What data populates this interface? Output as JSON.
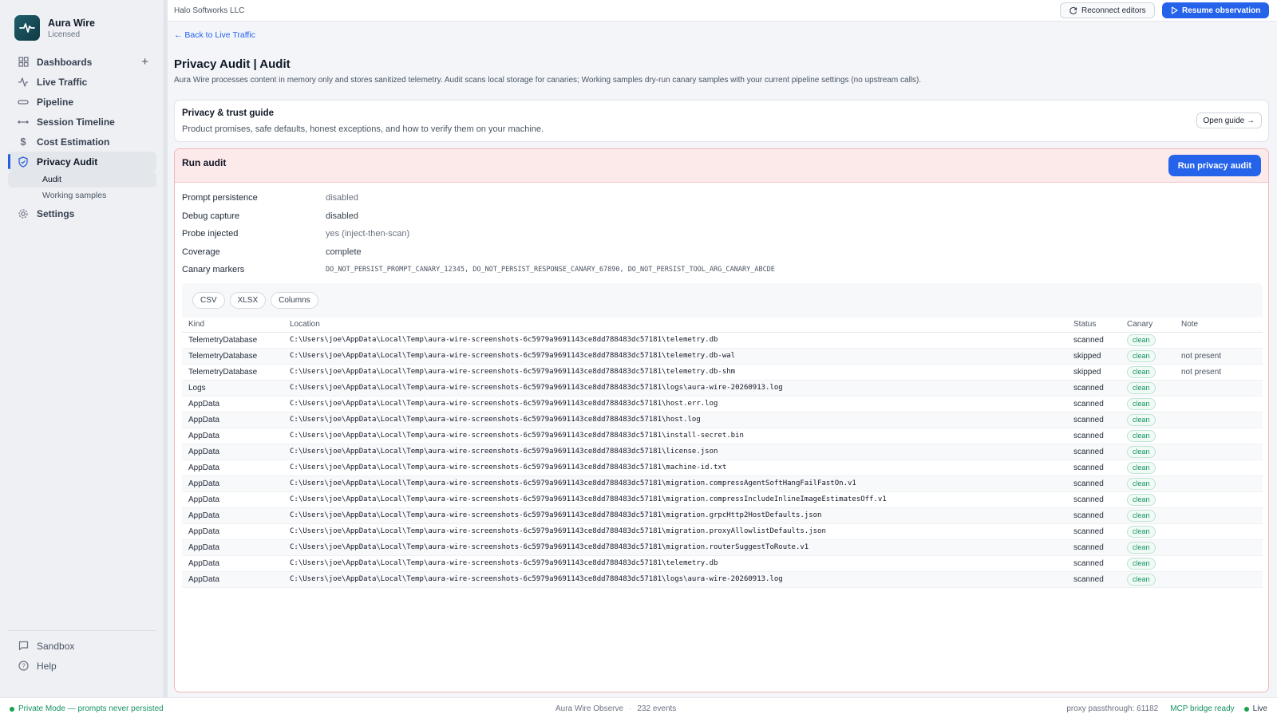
{
  "brand": {
    "name": "Aura Wire",
    "license": "Licensed"
  },
  "nav": {
    "dashboards": "Dashboards",
    "live_traffic": "Live Traffic",
    "pipeline": "Pipeline",
    "session_timeline": "Session Timeline",
    "cost_estimation": "Cost Estimation",
    "privacy_audit": "Privacy Audit",
    "sub_audit": "Audit",
    "sub_working_samples": "Working samples",
    "settings": "Settings"
  },
  "sidebar_bottom": {
    "sandbox": "Sandbox",
    "help": "Help"
  },
  "topbar": {
    "company": "Halo Softworks LLC",
    "reconnect": "Reconnect editors",
    "resume": "Resume observation"
  },
  "page": {
    "back": "← Back to Live Traffic",
    "title": "Privacy Audit | Audit",
    "description": "Aura Wire processes content in memory only and stores sanitized telemetry. Audit scans local storage for canaries; Working samples dry-run canary samples with your current pipeline settings (no upstream calls)."
  },
  "guide": {
    "title": "Privacy & trust guide",
    "description": "Product promises, safe defaults, honest exceptions, and how to verify them on your machine.",
    "button": "Open guide →"
  },
  "audit": {
    "title": "Run audit",
    "run_button": "Run privacy audit",
    "fields": {
      "prompt_persistence": {
        "label": "Prompt persistence",
        "value": "disabled"
      },
      "debug_capture": {
        "label": "Debug capture",
        "value": "disabled"
      },
      "probe_injected": {
        "label": "Probe injected",
        "value": "yes (inject-then-scan)"
      },
      "coverage": {
        "label": "Coverage",
        "value": "complete"
      },
      "canary_markers": {
        "label": "Canary markers",
        "value": "DO_NOT_PERSIST_PROMPT_CANARY_12345, DO_NOT_PERSIST_RESPONSE_CANARY_67890, DO_NOT_PERSIST_TOOL_ARG_CANARY_ABCDE"
      }
    }
  },
  "toolbar": {
    "csv": "CSV",
    "xlsx": "XLSX",
    "columns": "Columns"
  },
  "table": {
    "headers": {
      "kind": "Kind",
      "location": "Location",
      "status": "Status",
      "canary": "Canary",
      "note": "Note"
    },
    "rows": [
      {
        "kind": "TelemetryDatabase",
        "location": "C:\\Users\\joe\\AppData\\Local\\Temp\\aura-wire-screenshots-6c5979a9691143ce8dd788483dc57181\\telemetry.db",
        "status": "scanned",
        "canary": "clean",
        "note": ""
      },
      {
        "kind": "TelemetryDatabase",
        "location": "C:\\Users\\joe\\AppData\\Local\\Temp\\aura-wire-screenshots-6c5979a9691143ce8dd788483dc57181\\telemetry.db-wal",
        "status": "skipped",
        "canary": "clean",
        "note": "not present"
      },
      {
        "kind": "TelemetryDatabase",
        "location": "C:\\Users\\joe\\AppData\\Local\\Temp\\aura-wire-screenshots-6c5979a9691143ce8dd788483dc57181\\telemetry.db-shm",
        "status": "skipped",
        "canary": "clean",
        "note": "not present"
      },
      {
        "kind": "Logs",
        "location": "C:\\Users\\joe\\AppData\\Local\\Temp\\aura-wire-screenshots-6c5979a9691143ce8dd788483dc57181\\logs\\aura-wire-20260913.log",
        "status": "scanned",
        "canary": "clean",
        "note": ""
      },
      {
        "kind": "AppData",
        "location": "C:\\Users\\joe\\AppData\\Local\\Temp\\aura-wire-screenshots-6c5979a9691143ce8dd788483dc57181\\host.err.log",
        "status": "scanned",
        "canary": "clean",
        "note": ""
      },
      {
        "kind": "AppData",
        "location": "C:\\Users\\joe\\AppData\\Local\\Temp\\aura-wire-screenshots-6c5979a9691143ce8dd788483dc57181\\host.log",
        "status": "scanned",
        "canary": "clean",
        "note": ""
      },
      {
        "kind": "AppData",
        "location": "C:\\Users\\joe\\AppData\\Local\\Temp\\aura-wire-screenshots-6c5979a9691143ce8dd788483dc57181\\install-secret.bin",
        "status": "scanned",
        "canary": "clean",
        "note": ""
      },
      {
        "kind": "AppData",
        "location": "C:\\Users\\joe\\AppData\\Local\\Temp\\aura-wire-screenshots-6c5979a9691143ce8dd788483dc57181\\license.json",
        "status": "scanned",
        "canary": "clean",
        "note": ""
      },
      {
        "kind": "AppData",
        "location": "C:\\Users\\joe\\AppData\\Local\\Temp\\aura-wire-screenshots-6c5979a9691143ce8dd788483dc57181\\machine-id.txt",
        "status": "scanned",
        "canary": "clean",
        "note": ""
      },
      {
        "kind": "AppData",
        "location": "C:\\Users\\joe\\AppData\\Local\\Temp\\aura-wire-screenshots-6c5979a9691143ce8dd788483dc57181\\migration.compressAgentSoftHangFailFastOn.v1",
        "status": "scanned",
        "canary": "clean",
        "note": ""
      },
      {
        "kind": "AppData",
        "location": "C:\\Users\\joe\\AppData\\Local\\Temp\\aura-wire-screenshots-6c5979a9691143ce8dd788483dc57181\\migration.compressIncludeInlineImageEstimatesOff.v1",
        "status": "scanned",
        "canary": "clean",
        "note": ""
      },
      {
        "kind": "AppData",
        "location": "C:\\Users\\joe\\AppData\\Local\\Temp\\aura-wire-screenshots-6c5979a9691143ce8dd788483dc57181\\migration.grpcHttp2HostDefaults.json",
        "status": "scanned",
        "canary": "clean",
        "note": ""
      },
      {
        "kind": "AppData",
        "location": "C:\\Users\\joe\\AppData\\Local\\Temp\\aura-wire-screenshots-6c5979a9691143ce8dd788483dc57181\\migration.proxyAllowlistDefaults.json",
        "status": "scanned",
        "canary": "clean",
        "note": ""
      },
      {
        "kind": "AppData",
        "location": "C:\\Users\\joe\\AppData\\Local\\Temp\\aura-wire-screenshots-6c5979a9691143ce8dd788483dc57181\\migration.routerSuggestToRoute.v1",
        "status": "scanned",
        "canary": "clean",
        "note": ""
      },
      {
        "kind": "AppData",
        "location": "C:\\Users\\joe\\AppData\\Local\\Temp\\aura-wire-screenshots-6c5979a9691143ce8dd788483dc57181\\telemetry.db",
        "status": "scanned",
        "canary": "clean",
        "note": ""
      },
      {
        "kind": "AppData",
        "location": "C:\\Users\\joe\\AppData\\Local\\Temp\\aura-wire-screenshots-6c5979a9691143ce8dd788483dc57181\\logs\\aura-wire-20260913.log",
        "status": "scanned",
        "canary": "clean",
        "note": ""
      }
    ]
  },
  "statusbar": {
    "private_mode": "Private Mode — prompts never persisted",
    "app": "Aura Wire Observe",
    "events": "232 events",
    "proxy": "proxy passthrough: 61182",
    "mcp": "MCP bridge ready",
    "live": "Live"
  },
  "colors": {
    "accent": "#2563eb",
    "clean": "#15935f",
    "audit_header": "#fce9e9"
  }
}
